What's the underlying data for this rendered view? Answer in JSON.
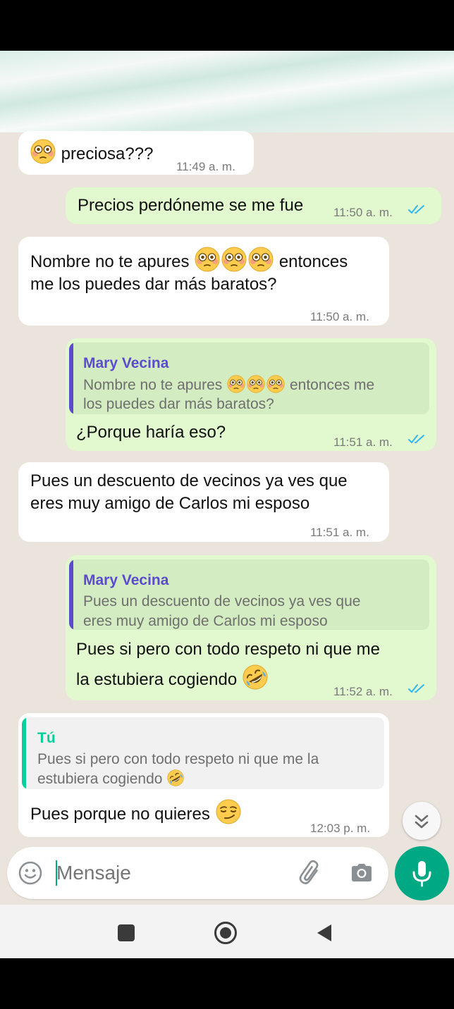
{
  "composer": {
    "placeholder": "Mensaje",
    "icons": [
      "emoji-icon",
      "attach-icon",
      "camera-icon",
      "mic-icon"
    ]
  },
  "messages": [
    {
      "direction": "in",
      "text": "preciosa???",
      "time": "11:49 a. m."
    },
    {
      "direction": "out",
      "text": "Precios perdóneme se me fue",
      "time": "11:50 a. m.",
      "status": "read"
    },
    {
      "direction": "in",
      "text_line1_a": "Nombre no te apures",
      "text_line1_b": "entonces",
      "text_line2": "me los puedes dar más baratos?",
      "time": "11:50 a. m."
    },
    {
      "direction": "out",
      "quote": {
        "author": "Mary Vecina",
        "line1_a": "Nombre no te apures",
        "line1_b": "entonces me",
        "line2": "los puedes dar más baratos?"
      },
      "text": "¿Porque haría eso?",
      "time": "11:51 a. m.",
      "status": "read"
    },
    {
      "direction": "in",
      "text_line1": "Pues un descuento de vecinos ya ves que",
      "text_line2": "eres muy amigo de Carlos mi esposo",
      "time": "11:51 a. m."
    },
    {
      "direction": "out",
      "quote": {
        "author": "Mary Vecina",
        "line1": "Pues un descuento de vecinos ya ves que",
        "line2": "eres muy amigo de Carlos mi esposo"
      },
      "text_line1": "Pues si pero con todo respeto ni que me",
      "text_line2": "la estubiera cogiendo",
      "time": "11:52 a. m.",
      "status": "read"
    },
    {
      "direction": "in",
      "quote": {
        "author": "Tú",
        "line1": "Pues si pero con todo respeto ni que me la",
        "line2": "estubiera cogiendo"
      },
      "text": "Pues porque no quieres",
      "time": "12:03 p. m."
    }
  ],
  "colors": {
    "incoming_bubble": "#ffffff",
    "outgoing_bubble": "#e2f8cf",
    "read_ticks": "#34b7f1",
    "quote_bar_mary": "#5b4ccf",
    "quote_bar_you": "#06cf9c",
    "accent": "#00a884"
  }
}
